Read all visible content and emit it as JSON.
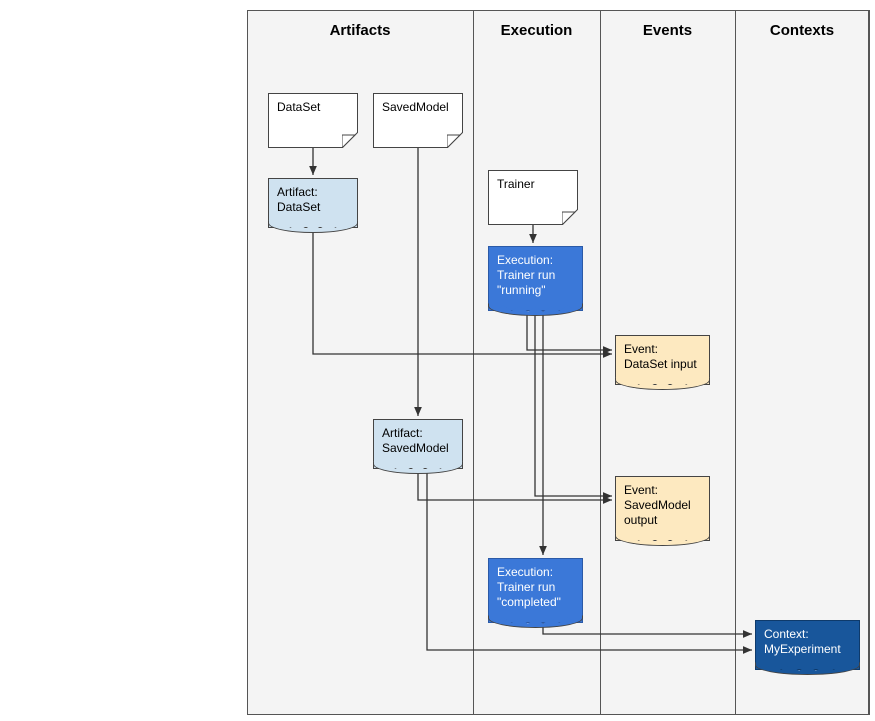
{
  "columns": {
    "artifacts": "Artifacts",
    "execution": "Execution",
    "events": "Events",
    "contexts": "Contexts"
  },
  "docs": {
    "dataset": "DataSet",
    "savedmodel": "SavedModel",
    "trainer": "Trainer"
  },
  "tags": {
    "artifact_dataset": "Artifact:\nDataSet",
    "artifact_savedmodel": "Artifact:\nSavedModel",
    "exec_running": "Execution:\nTrainer run\n\"running\"",
    "exec_completed": "Execution:\nTrainer run\n\"completed\"",
    "event_dataset_input": "Event:\nDataSet input",
    "event_savedmodel_output": "Event:\nSavedModel\noutput",
    "context_myexperiment": "Context:\nMyExperiment"
  }
}
